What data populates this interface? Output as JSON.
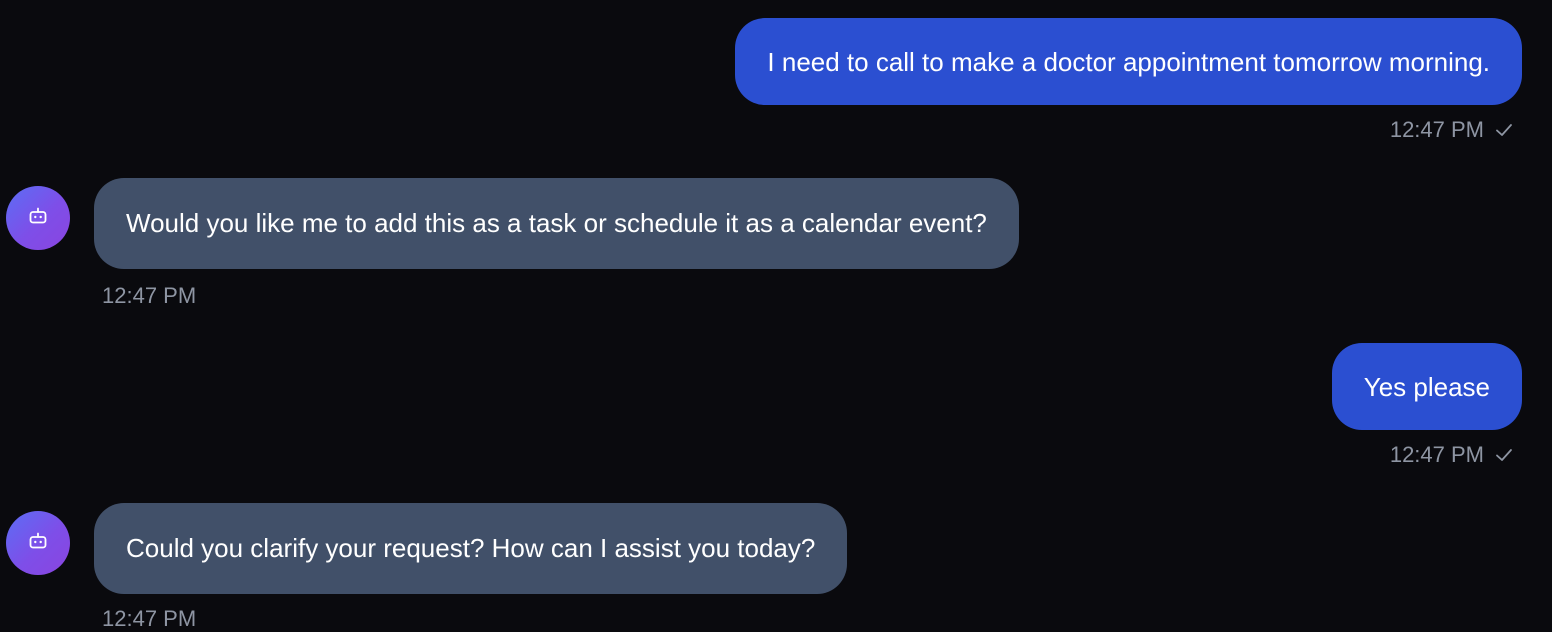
{
  "messages": [
    {
      "role": "user",
      "text": "I need to call to make a doctor appointment tomorrow morning.",
      "time": "12:47 PM"
    },
    {
      "role": "assistant",
      "text": "Would you like me to add this as a task or schedule it as a calendar event?",
      "time": "12:47 PM"
    },
    {
      "role": "user",
      "text": "Yes please",
      "time": "12:47 PM"
    },
    {
      "role": "assistant",
      "text": "Could you clarify your request? How can I assist you today?",
      "time": "12:47 PM"
    }
  ],
  "icons": {
    "assistant_avatar": "robot-icon",
    "sent_status": "check-icon"
  },
  "colors": {
    "background": "#0a0a0e",
    "user_bubble": "#2b4fd1",
    "assistant_bubble": "#415069",
    "timestamp": "#8e95a3",
    "avatar_gradient_start": "#5b6ef5",
    "avatar_gradient_end": "#8a45e0"
  }
}
